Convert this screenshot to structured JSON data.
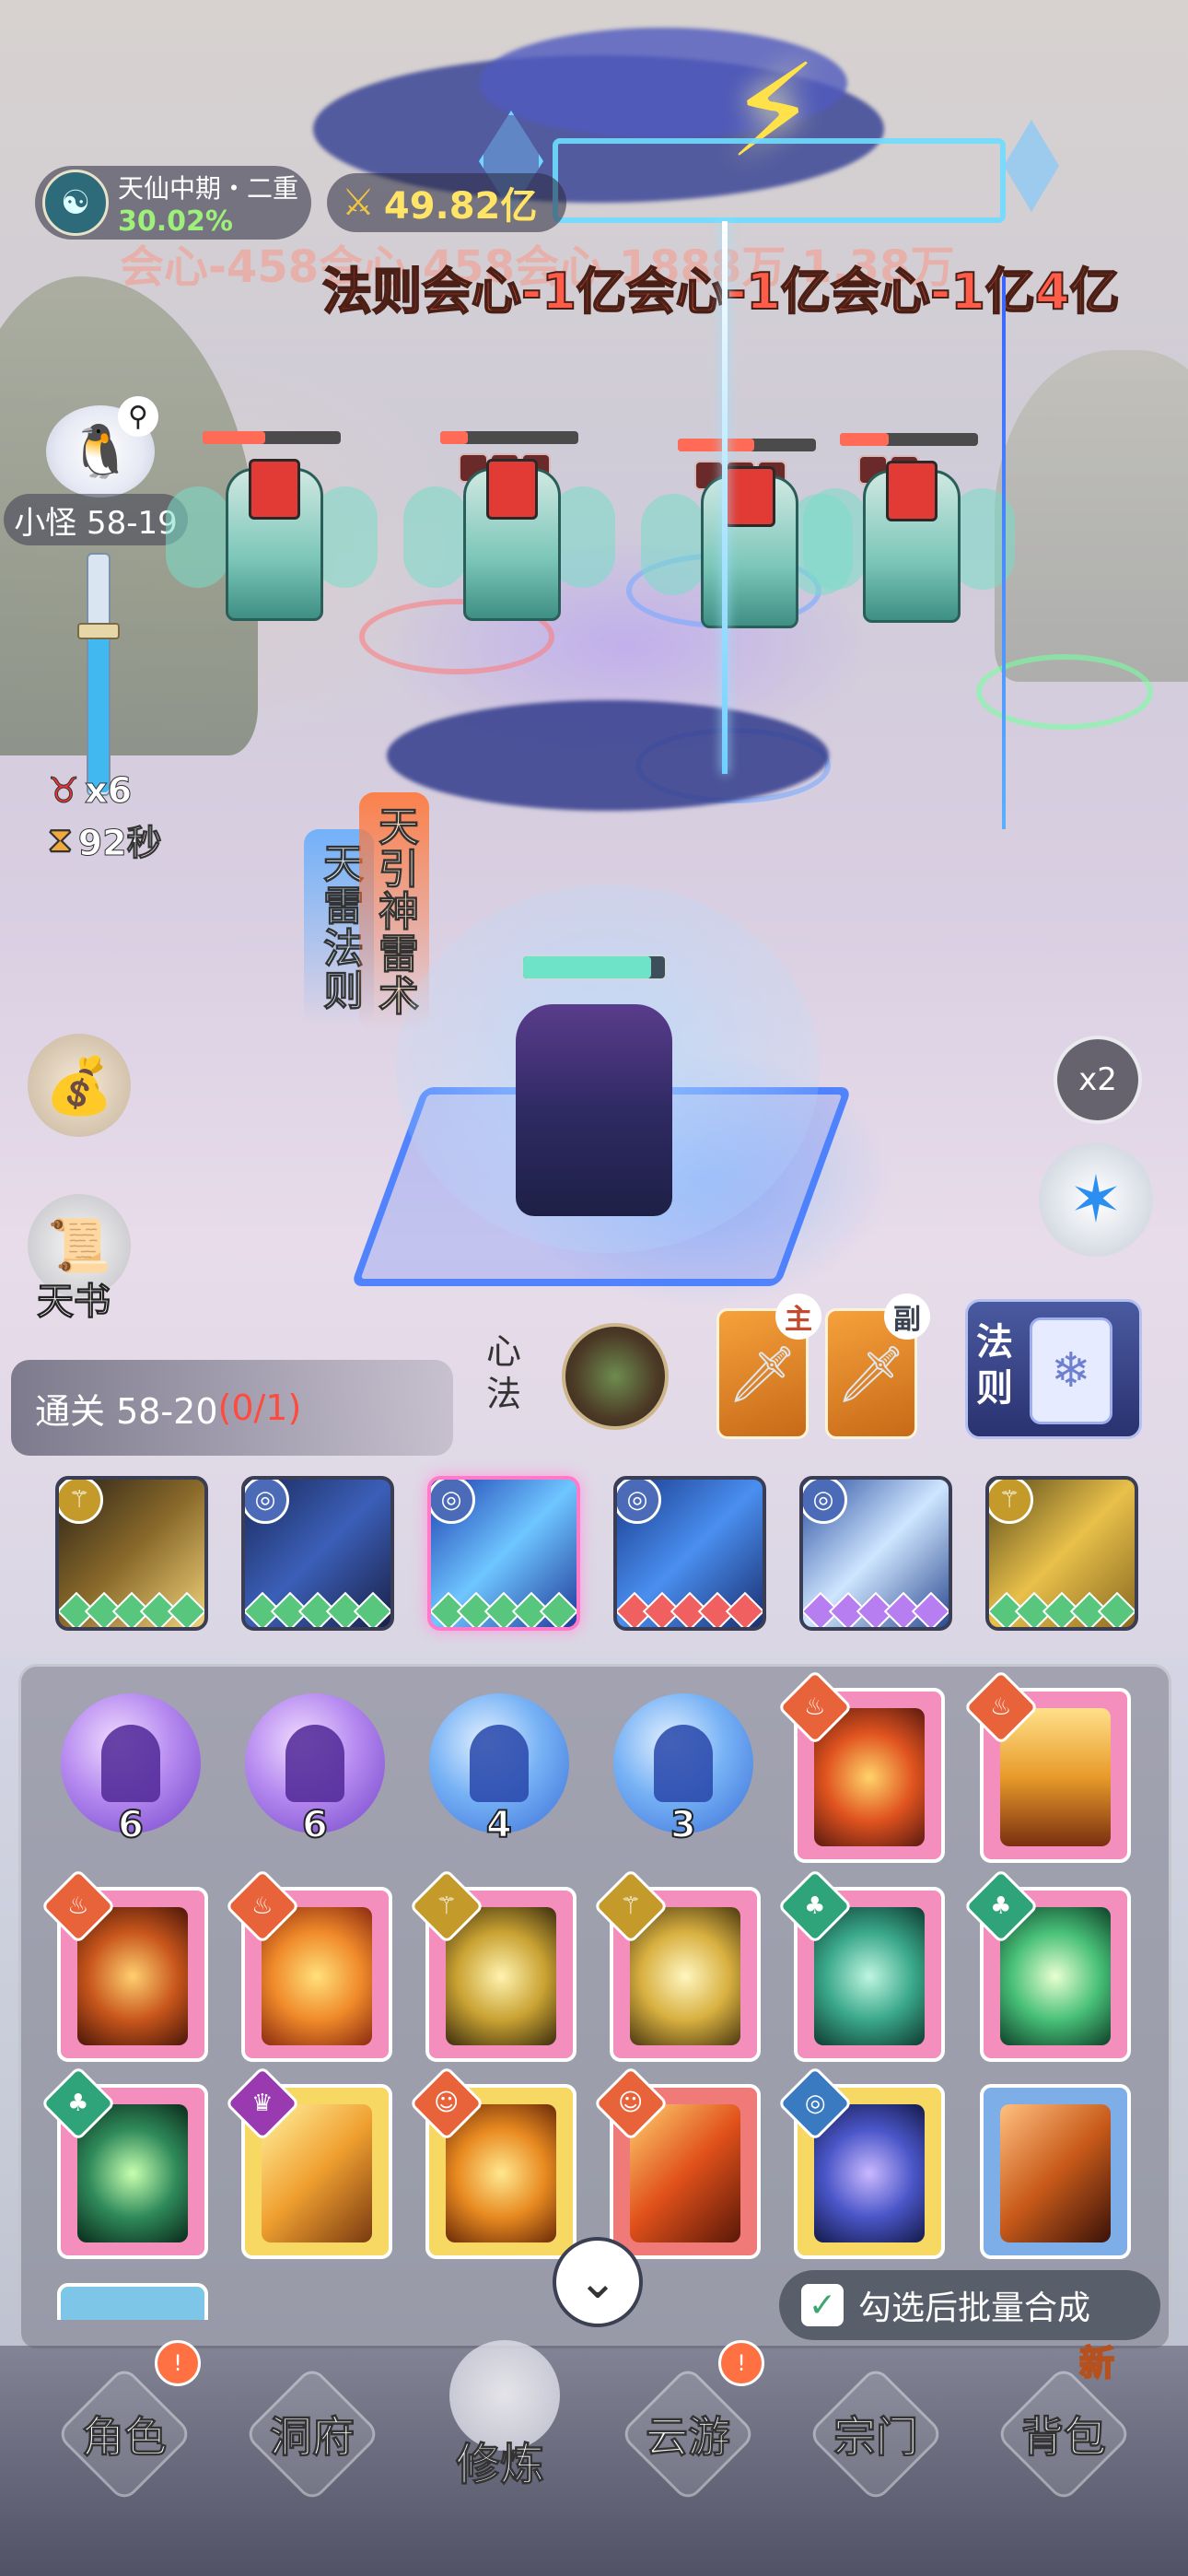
{
  "status": {
    "realm": "天仙中期・二重",
    "realm_progress": "30.02%",
    "power": "49.82亿"
  },
  "damage_popups": {
    "line1_faded": "会心-458会心 458会心 1888万 1.38万",
    "row": [
      {
        "text": "法则",
        "style": "red"
      },
      {
        "text": "会心-1亿",
        "style": "red"
      },
      {
        "text": "会心-1亿",
        "style": "red"
      },
      {
        "text": "会心-1亿",
        "style": "red"
      },
      {
        "text": "4亿",
        "style": "red"
      }
    ]
  },
  "stage": {
    "label": "小怪 58-19",
    "wave_multiplier": "x6",
    "timer": "92秒",
    "progress_fraction": 0.65
  },
  "enemies": [
    {
      "hp_fraction": 0.45
    },
    {
      "hp_fraction": 0.2
    },
    {
      "hp_fraction": 0.55
    },
    {
      "hp_fraction": 0.35
    }
  ],
  "skills": {
    "primary": "天雷法则",
    "secondary": "天引神雷术"
  },
  "side_buttons": {
    "book_label": "天书",
    "speed_label": "x2"
  },
  "stage_clear": {
    "prefix": "通关 58-20",
    "progress": "(0/1)"
  },
  "loadout": {
    "xinfa_label": "心法",
    "main_weapon_tag": "主",
    "sub_weapon_tag": "副",
    "fa_label": "法则"
  },
  "equipment": [
    {
      "element": "gold",
      "gems": "green"
    },
    {
      "element": "blue",
      "gems": "green"
    },
    {
      "element": "blue",
      "gems": "green",
      "selected": true
    },
    {
      "element": "blue",
      "gems": "red"
    },
    {
      "element": "blue",
      "gems": "purple"
    },
    {
      "element": "gold",
      "gems": "green"
    }
  ],
  "inventory": {
    "orbs": [
      {
        "color": "purple",
        "count": "6"
      },
      {
        "color": "purple",
        "count": "6"
      },
      {
        "color": "blue",
        "count": "4"
      },
      {
        "color": "blue",
        "count": "3"
      }
    ],
    "batch_label": "勾选后批量合成"
  },
  "tabs": [
    {
      "label": "角色",
      "badge": true
    },
    {
      "label": "洞府"
    },
    {
      "label": "修炼",
      "active": true
    },
    {
      "label": "云游",
      "badge": true
    },
    {
      "label": "宗门"
    },
    {
      "label": "背包"
    }
  ],
  "new_badge": "新",
  "colors": {
    "accent_yellow": "#ffe466",
    "progress_green": "#9df07a",
    "damage_red": "#ff5c4a",
    "card_pink": "#f48ebd"
  }
}
